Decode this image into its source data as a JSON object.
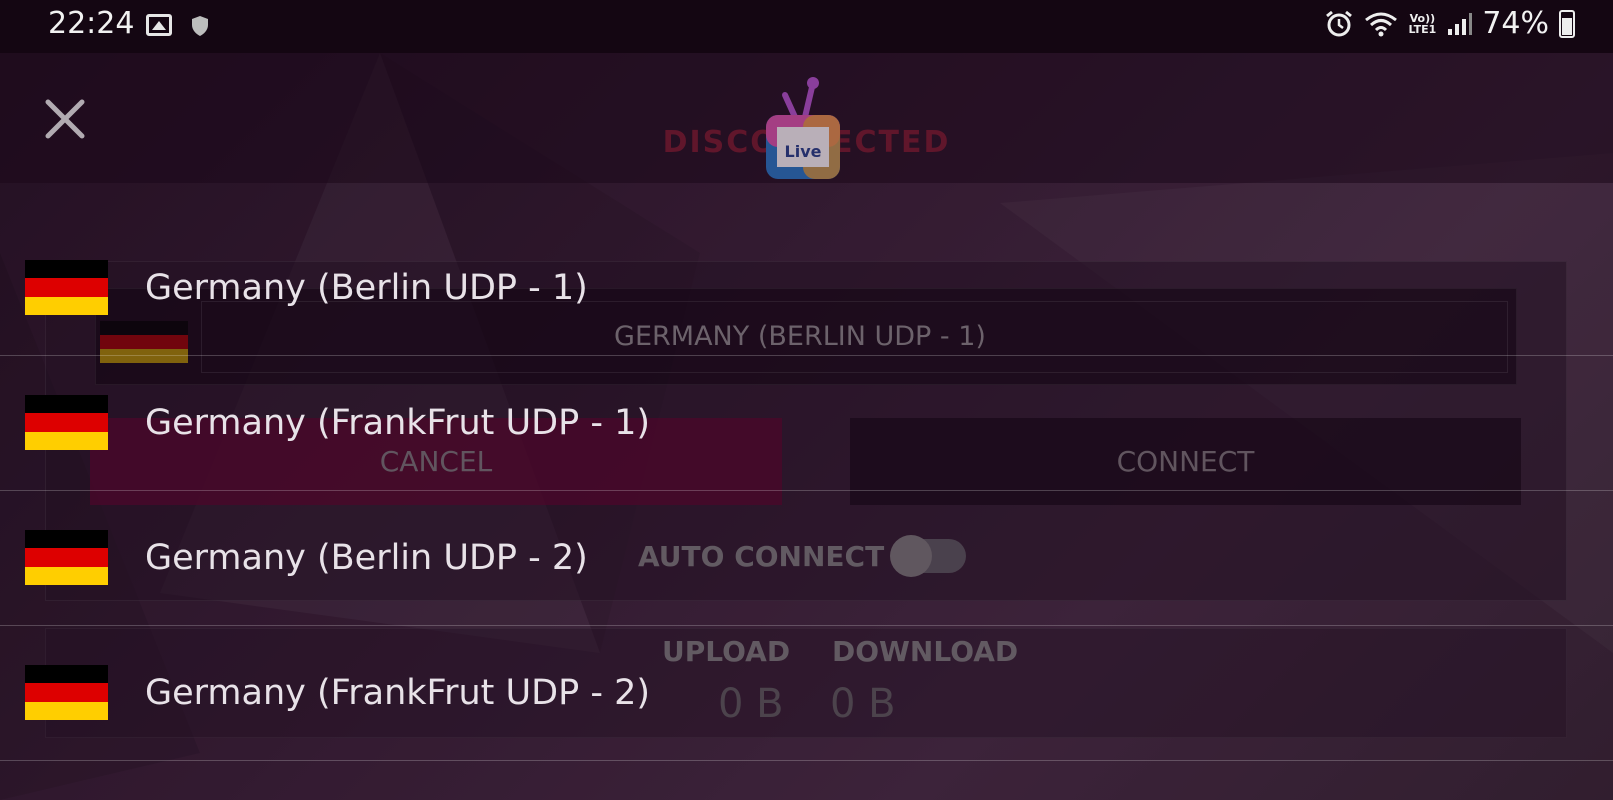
{
  "status_bar": {
    "time": "22:24",
    "volte_top": "Vo))",
    "volte_bottom": "LTE1",
    "battery_percent": "74%"
  },
  "app": {
    "connection_status": "DISCONNECTED",
    "selected_server": "GERMANY (BERLIN UDP - 1)",
    "cancel_label": "CANCEL",
    "connect_label": "CONNECT",
    "auto_connect_label": "AUTO CONNECT",
    "auto_connect_on": false,
    "upload_label": "UPLOAD",
    "download_label": "DOWNLOAD",
    "upload_value": "0 B",
    "download_value": "0 B"
  },
  "servers": [
    {
      "name": "Germany (Berlin UDP - 1)",
      "flag": "germany-flag"
    },
    {
      "name": "Germany (FrankFrut UDP - 1)",
      "flag": "germany-flag"
    },
    {
      "name": "Germany (Berlin UDP - 2)",
      "flag": "germany-flag"
    },
    {
      "name": "Germany (FrankFrut UDP - 2)",
      "flag": "germany-flag"
    }
  ],
  "colors": {
    "status_bar_bg": "#140612",
    "cancel_bg": "#5f0532",
    "status_text": "#7a1a33"
  }
}
